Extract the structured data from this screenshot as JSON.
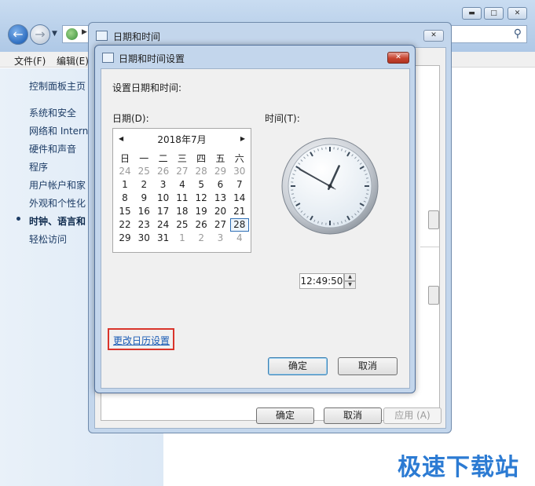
{
  "control_panel": {
    "menu": [
      "文件(F)",
      "编辑(E)"
    ],
    "sidebar_home": "控制面板主页",
    "sidebar_items": [
      "系统和安全",
      "网络和 Intern",
      "硬件和声音",
      "程序",
      "用户帐户和家",
      "外观和个性化",
      "时钟、语言和",
      "轻松访问"
    ]
  },
  "dt_dialog": {
    "title": "日期和时间",
    "ok": "确定",
    "cancel": "取消",
    "apply": "应用 (A)"
  },
  "settings_dialog": {
    "title": "日期和时间设置",
    "heading": "设置日期和时间:",
    "date_label": "日期(D):",
    "time_label": "时间(T):",
    "calendar": {
      "month_title": "2018年7月",
      "weekdays": [
        "日",
        "一",
        "二",
        "三",
        "四",
        "五",
        "六"
      ],
      "weeks": [
        [
          "24",
          "25",
          "26",
          "27",
          "28",
          "29",
          "30"
        ],
        [
          "1",
          "2",
          "3",
          "4",
          "5",
          "6",
          "7"
        ],
        [
          "8",
          "9",
          "10",
          "11",
          "12",
          "13",
          "14"
        ],
        [
          "15",
          "16",
          "17",
          "18",
          "19",
          "20",
          "21"
        ],
        [
          "22",
          "23",
          "24",
          "25",
          "26",
          "27",
          "28"
        ],
        [
          "29",
          "30",
          "31",
          "1",
          "2",
          "3",
          "4"
        ]
      ],
      "selected_day": "28"
    },
    "time_value": "12:49:50",
    "clock": {
      "hour": 12,
      "minute": 49,
      "second": 50
    },
    "change_calendar_link": "更改日历设置",
    "ok": "确定",
    "cancel": "取消"
  },
  "watermark": "极速下载站"
}
